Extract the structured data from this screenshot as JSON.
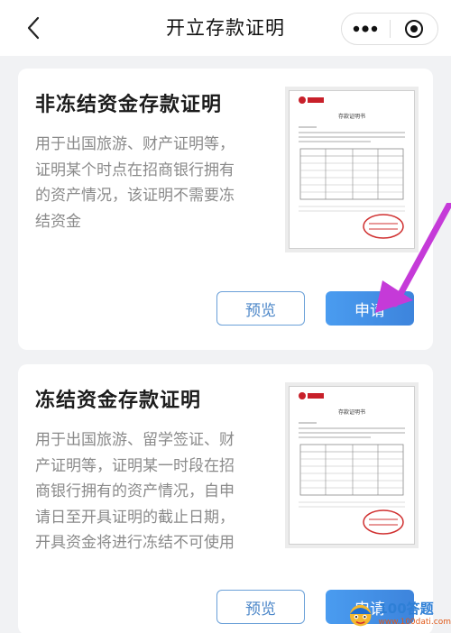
{
  "header": {
    "title": "开立存款证明",
    "back_icon": "chevron-left-icon",
    "more_icon": "more-dots-icon",
    "close_icon": "target-circle-icon"
  },
  "cards": [
    {
      "title": "非冻结资金存款证明",
      "desc_lines": [
        "用于出国旅游、财产证明等，",
        "证明某个时点在招商银行拥有",
        "的资产情况，该证明不需要冻",
        "结资金"
      ],
      "preview_label": "预览",
      "apply_label": "申请",
      "thumb_title": "存款证明书"
    },
    {
      "title": "冻结资金存款证明",
      "desc_lines": [
        "用于出国旅游、留学签证、财",
        "产证明等，证明某一时段在招",
        "商银行拥有的资产情况，自申",
        "请日至开具证明的截止日期，",
        "开具资金将进行冻结不可使用"
      ],
      "preview_label": "预览",
      "apply_label": "申请",
      "thumb_title": "存款证明书"
    }
  ],
  "annotation": {
    "arrow_color": "#c53ad8"
  },
  "watermark": {
    "brand": "100答题",
    "url": "www.100dati.com"
  },
  "colors": {
    "accent": "#3f8fe6",
    "preview_border": "#6aa0d8",
    "background": "#f1f2f4"
  }
}
